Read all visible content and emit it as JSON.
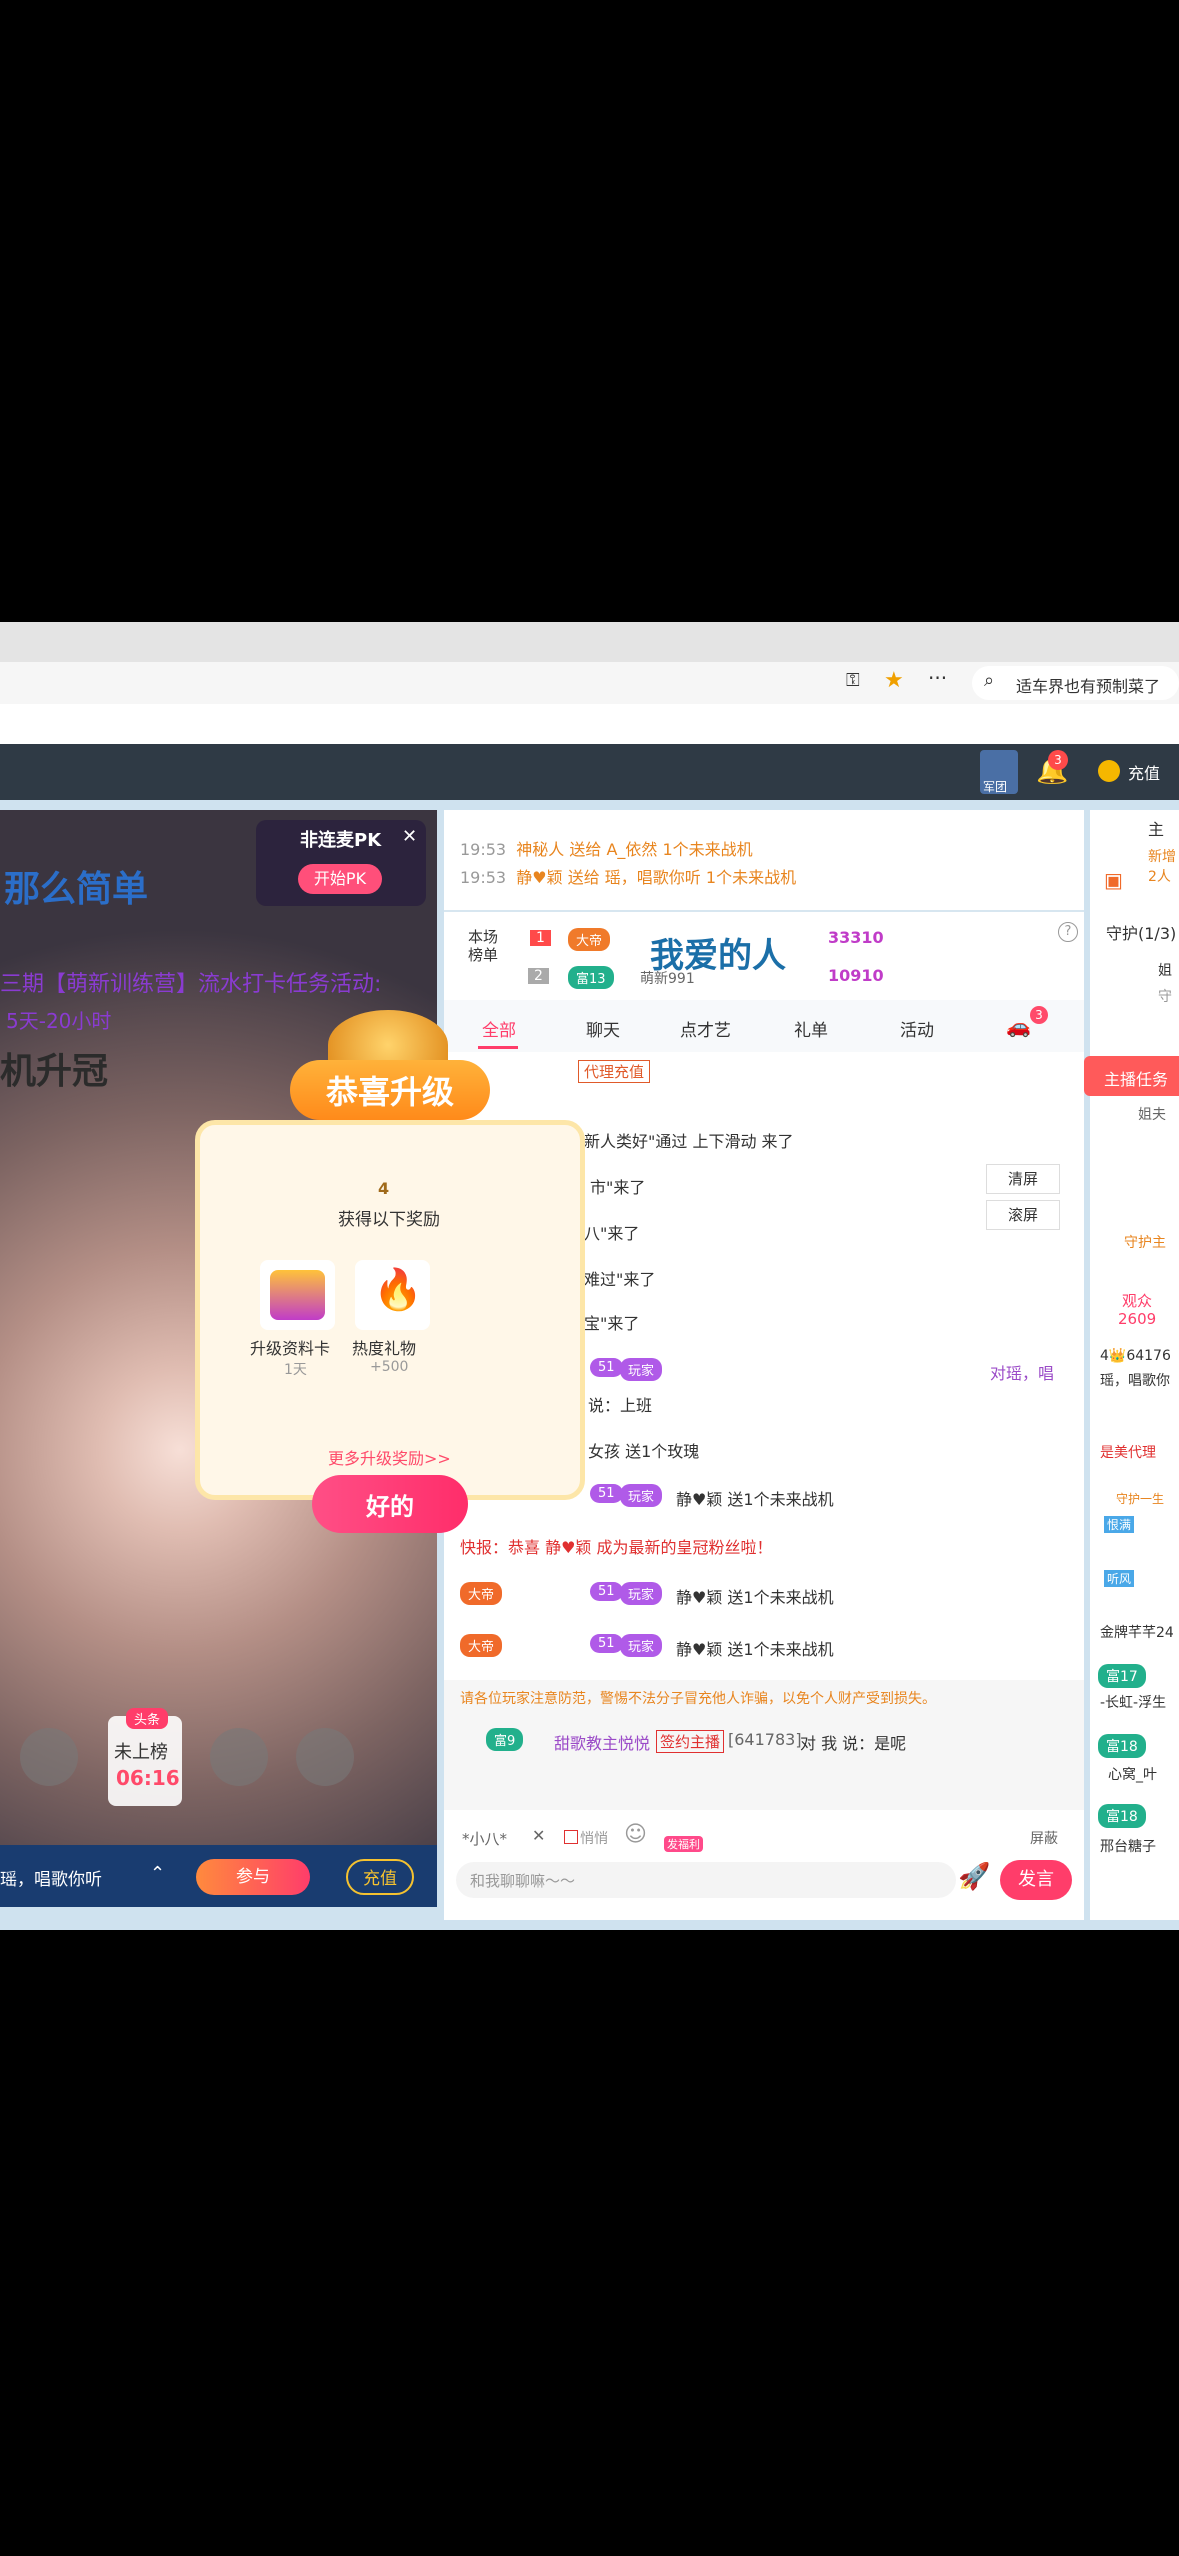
{
  "browser": {
    "search_placeholder": "适车界也有预制菜了",
    "menu_dots": "···"
  },
  "site_nav": {
    "legion_label": "军团",
    "notif_count": "3",
    "recharge_label": "充值"
  },
  "video": {
    "title_text": "那么简单",
    "task_text": "三期【萌新训练营】流水打卡任务活动:",
    "task_sub": "5天-20小时",
    "upgrade_text": "机升冠",
    "pk_title": "非连麦PK",
    "pk_button": "开始PK",
    "seat_badge": "头条",
    "seat_status": "未上榜",
    "seat_time": "06:16",
    "ticker": "瑶，唱歌你听",
    "join_button": "参与",
    "recharge_button": "充值"
  },
  "popup": {
    "title": "恭喜升级",
    "level": "4",
    "subtitle": "获得以下奖励",
    "reward1_name": "升级资料卡",
    "reward1_value": "1天",
    "reward2_name": "热度礼物",
    "reward2_value": "+500",
    "more_link": "更多升级奖励>>",
    "ok_button": "好的"
  },
  "chat": {
    "gift_lines": [
      {
        "time": "19:53",
        "text": "神秘人 送给 A_依然 1个未来战机"
      },
      {
        "time": "19:53",
        "text": "静♥颖 送给 瑶，唱歌你听 1个未来战机"
      }
    ],
    "rank_title": "本场榜单",
    "rank1_num": "1",
    "rank1_badge": "大帝",
    "rank1_score": "33310",
    "rank2_num": "2",
    "rank2_badge": "富13",
    "rank2_name": "萌新991",
    "rank2_score": "10910",
    "overlay_text": "我爱的人",
    "tabs": [
      "全部",
      "聊天",
      "点才艺",
      "礼单",
      "活动"
    ],
    "car_badge": "3",
    "agent_tag": "代理充值",
    "clear_button": "清屏",
    "scroll_button": "滚屏",
    "messages": [
      "新人类好\"通过 上下滑动 来了",
      "市\"来了",
      "八\"来了",
      "难过\"来了",
      "宝\"来了",
      "对瑶，唱",
      "说：上班",
      "女孩 送1个玫瑰",
      "静♥颖 送1个未来战机",
      "快报：恭喜 静♥颖 成为最新的皇冠粉丝啦！",
      "静♥颖 送1个未来战机",
      "静♥颖 送1个未来战机"
    ],
    "badge_dadi": "大帝",
    "badge_wanjia": "玩家",
    "badge_51": "51",
    "warning": "请各位玩家注意防范，警惕不法分子冒充他人诈骗，以免个人财产受到损失。",
    "user_msg_badge": "富9",
    "user_msg_name": "甜歌教主悦悦",
    "user_msg_tag": "签约主播",
    "user_msg_id": "[641783]",
    "user_msg_text": "对 我 说：是呢",
    "target_name": "*小八*",
    "whisper_label": "悄悄",
    "mask_label": "屏蔽",
    "input_placeholder": "和我聊聊嘛～～",
    "send_button": "发言",
    "gift_label": "发福利"
  },
  "right_col": {
    "anchor_label": "主",
    "new_label": "新增",
    "count_label": "2人",
    "guard_title": "守护(1/3)",
    "guard_name": "姐",
    "guard_sub": "守",
    "anchor_task": "主播任务",
    "sister": "姐夫",
    "guard_anchor": "守护主",
    "audience_label": "观众",
    "audience_count": "2609",
    "aud_id": "4👑64176",
    "aud_text": "瑶，唱歌你",
    "beauty_agent": "是美代理",
    "guard_one": "守护一生",
    "tag1": "恨满",
    "tag2": "听风",
    "tag3": "金牌芊芊24",
    "badge_fu17": "富17",
    "text_fu17": "-长虹-浮生",
    "badge_fu18a": "富18",
    "text_fu18a": "心窝_叶",
    "badge_fu18b": "富18",
    "text_fu18b": "邢台糖子"
  },
  "colors": {
    "accent_pink": "#ff2d6a",
    "nav_dark": "#2f3a45",
    "video_bar": "#193c70"
  }
}
